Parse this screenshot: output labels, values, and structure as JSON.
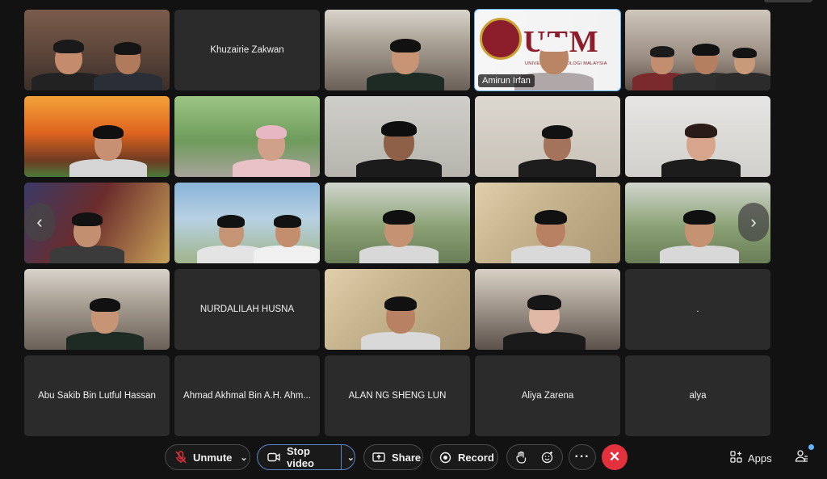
{
  "participants_visible": [
    {
      "id": "p1",
      "name": "",
      "type": "video",
      "scene": "room-sign"
    },
    {
      "id": "p2",
      "name": "Khuzairie Zakwan",
      "type": "name"
    },
    {
      "id": "p3",
      "name": "",
      "type": "video",
      "scene": "cafe"
    },
    {
      "id": "p4",
      "name": "Amirun Irfan",
      "type": "video",
      "scene": "logo",
      "label": "Amirun Irfan",
      "logo_text": "UTM",
      "logo_subtext": "UNIVERSITI TEKNOLOGI MALAYSIA",
      "active_speaker": true
    },
    {
      "id": "p5",
      "name": "",
      "type": "video",
      "scene": "group"
    },
    {
      "id": "p6",
      "name": "",
      "type": "video",
      "scene": "fire"
    },
    {
      "id": "p7",
      "name": "",
      "type": "video",
      "scene": "outdoor-hijab"
    },
    {
      "id": "p8",
      "name": "",
      "type": "video",
      "scene": "headset"
    },
    {
      "id": "p9",
      "name": "",
      "type": "video",
      "scene": "plain-hijab"
    },
    {
      "id": "p10",
      "name": "",
      "type": "video",
      "scene": "plain-girl"
    },
    {
      "id": "p11",
      "name": "",
      "type": "video",
      "scene": "game-bg"
    },
    {
      "id": "p12",
      "name": "",
      "type": "video",
      "scene": "arch"
    },
    {
      "id": "p13",
      "name": "",
      "type": "video",
      "scene": "park-room"
    },
    {
      "id": "p14",
      "name": "",
      "type": "video",
      "scene": "sun-wall"
    },
    {
      "id": "p15",
      "name": "",
      "type": "video",
      "scene": "park-room"
    },
    {
      "id": "p16",
      "name": "",
      "type": "video",
      "scene": "cafe"
    },
    {
      "id": "p17",
      "name": "NURDALILAH HUSNA",
      "type": "name"
    },
    {
      "id": "p18",
      "name": "",
      "type": "video",
      "scene": "sun-wall"
    },
    {
      "id": "p19",
      "name": "",
      "type": "video",
      "scene": "cafe-hijab"
    },
    {
      "id": "p20",
      "name": ".",
      "type": "name"
    },
    {
      "id": "p21",
      "name": "Abu Sakib Bin Lutful Hassan",
      "type": "name"
    },
    {
      "id": "p22",
      "name": "Ahmad Akhmal Bin A.H. Ahm...",
      "type": "name"
    },
    {
      "id": "p23",
      "name": "ALAN NG SHENG LUN",
      "type": "name"
    },
    {
      "id": "p24",
      "name": "Aliya Zarena",
      "type": "name"
    },
    {
      "id": "p25",
      "name": "alya",
      "type": "name"
    }
  ],
  "controls": {
    "unmute_label": "Unmute",
    "stop_video_label": "Stop video",
    "share_label": "Share",
    "record_label": "Record",
    "more_label": "···",
    "apps_label": "Apps"
  },
  "colors": {
    "background": "#121212",
    "tile": "#2b2b2b",
    "accent": "#64b4ff",
    "end_call": "#e3313e"
  },
  "icons": [
    "mic-muted-icon",
    "camera-icon",
    "share-screen-icon",
    "record-icon",
    "raise-hand-icon",
    "reactions-icon",
    "more-icon",
    "end-call-icon",
    "apps-icon",
    "participants-icon",
    "chevron-left-icon",
    "chevron-right-icon"
  ]
}
